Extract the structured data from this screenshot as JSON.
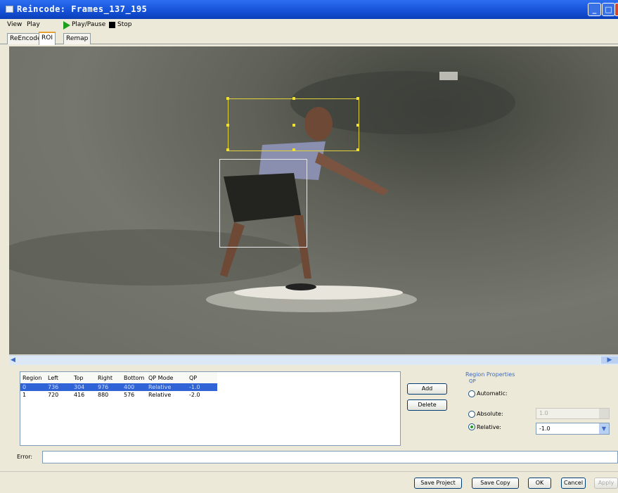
{
  "window": {
    "title": "Reincode: Frames_137_195"
  },
  "menu": {
    "view": "View",
    "play": "Play"
  },
  "toolbar": {
    "play_pause": "Play/Pause",
    "stop": "Stop"
  },
  "tabs": [
    "ReEncode",
    "ROI",
    "Remap"
  ],
  "roi_table": {
    "headers": [
      "Region",
      "Left",
      "Top",
      "Right",
      "Bottom",
      "QP Mode",
      "QP"
    ],
    "rows": [
      [
        "0",
        "736",
        "304",
        "976",
        "400",
        "Relative",
        "-1.0"
      ],
      [
        "1",
        "720",
        "416",
        "880",
        "576",
        "Relative",
        "-2.0"
      ]
    ]
  },
  "buttons": {
    "add": "Add",
    "delete": "Delete"
  },
  "region_properties": {
    "title": "Region Properties",
    "qp_label": "QP",
    "automatic": "Automatic:",
    "absolute": "Absolute:",
    "absolute_value": "1.0",
    "relative": "Relative:",
    "relative_value": "-1.0",
    "selected_mode": "Relative"
  },
  "error": {
    "label": "Error:",
    "value": ""
  },
  "footer": {
    "save_project": "Save Project",
    "save_copy": "Save Copy",
    "ok": "OK",
    "cancel": "Cancel",
    "apply": "Apply"
  },
  "colors": {
    "titlebar": "#1450d6",
    "selection": "#2f63d6",
    "roi_selected": "#e0d23a",
    "roi_other": "#e8e8e8",
    "play_icon": "#1ca01c"
  }
}
